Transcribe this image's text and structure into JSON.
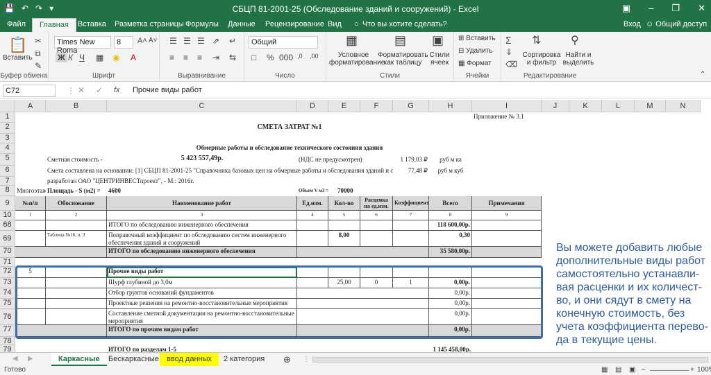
{
  "window": {
    "title": "СБЦП 81-2001-25 (Обследование зданий и сооружений) - Excel",
    "minimize_icon": "minimize-icon",
    "maximize_icon": "restore-icon",
    "close_icon": "close-icon"
  },
  "ribbon_tabs": [
    "Файл",
    "Главная",
    "Вставка",
    "Разметка страницы",
    "Формулы",
    "Данные",
    "Рецензирование",
    "Вид"
  ],
  "tell_me": "Что вы хотите сделать?",
  "signin": "Вход",
  "share": "Общий доступ",
  "ribbon": {
    "paste": "Вставить",
    "clipboard": "Буфер обмена",
    "font_name": "Times New Roma",
    "font_size": "8",
    "bold": "Ж",
    "italic": "К",
    "underline": "Ч",
    "font_group": "Шрифт",
    "align_group": "Выравнивание",
    "number_format": "Общий",
    "number_group": "Число",
    "cond_format_1": "Условное",
    "cond_format_2": "форматирование",
    "format_table_1": "Форматировать",
    "format_table_2": "как таблицу",
    "cell_styles_1": "Стили",
    "cell_styles_2": "ячеек",
    "styles_group": "Стили",
    "insert": "Вставить",
    "delete": "Удалить",
    "format": "Формат",
    "cells_group": "Ячейки",
    "sort_1": "Сортировка",
    "sort_2": "и фильтр",
    "find_1": "Найти и",
    "find_2": "выделить",
    "editing_group": "Редактирование"
  },
  "formula_bar": {
    "name_box": "C72",
    "fx": "fx",
    "content": "Прочие виды работ"
  },
  "columns": [
    "A",
    "B",
    "C",
    "D",
    "E",
    "F",
    "G",
    "H",
    "I",
    "J",
    "K",
    "L",
    "M",
    "N"
  ],
  "rows_hdr": [
    "1",
    "2",
    "3",
    "4",
    "5",
    "6",
    "7",
    "8",
    "9",
    "10",
    "68",
    "69",
    "70",
    "71",
    "72",
    "73",
    "74",
    "75",
    "76",
    "77",
    "78",
    "79"
  ],
  "sheet": {
    "appendix": "Приложение № 3.1",
    "title": "СМЕТА ЗАТРАТ №1",
    "subtitle": "Обмерные работы и обследование технического состояния здания",
    "cost_label": "Сметная стоимость -",
    "cost_value": "5 423 557,49р.",
    "vat": "(НДС не предусмотрен)",
    "rate1": "1 179,03 ₽",
    "rate1_unit": "руб м ка",
    "basis": "Смета составлена на основании:  [1] СБЦП 81-2001-25 \"Справочника базовых цен на обмерные работы и обследования зданий и сооруж",
    "rate2": "77,48 ₽",
    "rate2_unit": "руб м куб",
    "developer": "разработан ОАО \"ЦЕНТРИНВЕСТпроект\", - М.: 2016г.",
    "floors": "Многоэтажн",
    "area_label": "Площадь - S (м2) =",
    "area_value": "4600",
    "volume_label": "Объем V м3 =",
    "volume_value": "70000",
    "h_num": "№п/п",
    "h_basis": "Обоснование",
    "h_name": "Наименование работ",
    "h_unit": "Ед.изм.",
    "h_qty": "Кол-во",
    "h_price": "Расценка на ед.изм.",
    "h_coef": "Коэффициент",
    "h_total": "Всего",
    "h_notes": "Примечания",
    "idx": [
      "1",
      "2",
      "3",
      "4",
      "5",
      "6",
      "7",
      "8",
      "9"
    ],
    "r68_name": "ИТОГО по обследованию инженерного обеспечения",
    "r68_total": "118 600,00р.",
    "r69_basis": "Таблица №16, п. 3",
    "r69_name": "Поправочный коэффициент по обследованию систем инженерного обеспечения зданий и сооружений",
    "r69_qty": "8,00",
    "r69_total": "0,30",
    "r70_name": "ИТОГО по обследованию инженерного обеспечения",
    "r70_total": "35 580,00р.",
    "r72_num": "5",
    "r72_name": "Прочие виды работ",
    "r73_name": "Шурф глубиной до 3,0м",
    "r73_qty": "25,00",
    "r73_price": "0",
    "r73_coef": "1",
    "r73_total": "0,00р.",
    "r74_name": "Отбор грунтов оснований фундаментов",
    "r74_total": "0,00р.",
    "r75_name": "Проектные решения на ремонтно-восстановительные мероприятия",
    "r75_total": "0,00р.",
    "r76_name": "Составление сметной документации на ремонтно-восстановительные мероприятия",
    "r76_total": "0,00р.",
    "r77_name": "ИТОГО по прочим видам работ",
    "r77_total": "0,00р.",
    "r79_name": "ИТОГО по разделам 1-5",
    "r79_total": "1 145 458,00р."
  },
  "overlay_text": [
    "Вы можете добавить любые",
    "дополнительные виды работ",
    "самостоятельно устанавли-",
    "вая расценки и их количест-",
    "во, и они сядут в смету на",
    "конечную стоимость, без",
    "учета коэффициента перево-",
    "да в текущие цены."
  ],
  "sheet_tabs": [
    "Каркасные",
    "Бескаркасные",
    "ввод данных",
    "2 категория"
  ],
  "active_sheet_color": "#217346",
  "highlight_tab_color": "#ffff00",
  "status": {
    "ready": "Готово",
    "zoom": "100%"
  }
}
